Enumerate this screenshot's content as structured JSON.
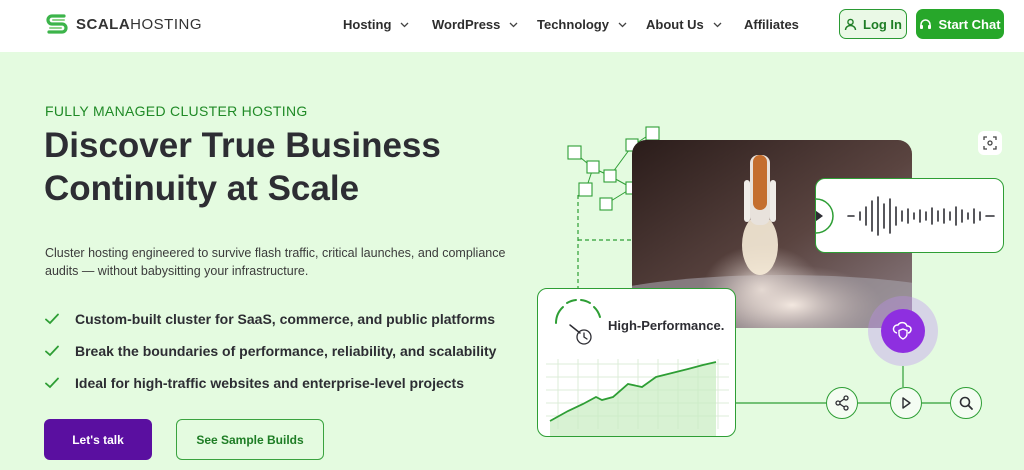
{
  "header": {
    "logo_text_bold": "SCALA",
    "logo_text_rest": "HOSTING",
    "nav": [
      {
        "label": "Hosting",
        "has_dropdown": true
      },
      {
        "label": "WordPress",
        "has_dropdown": true
      },
      {
        "label": "Technology",
        "has_dropdown": true
      },
      {
        "label": "About Us",
        "has_dropdown": true
      },
      {
        "label": "Affiliates",
        "has_dropdown": false
      }
    ],
    "login_label": "Log In",
    "chat_label": "Start Chat"
  },
  "hero": {
    "eyebrow": "FULLY MANAGED CLUSTER HOSTING",
    "headline_line1": "Discover True Business",
    "headline_line2": "Continuity at Scale",
    "subtext": "Cluster hosting engineered to survive flash traffic, critical launches, and compliance audits — without babysitting your infrastructure.",
    "features": [
      "Custom-built cluster for SaaS, commerce, and public platforms",
      "Break the boundaries of performance, reliability, and scalability",
      "Ideal for high-traffic websites and enterprise-level projects"
    ],
    "cta_primary": "Let's talk",
    "cta_secondary": "See Sample Builds"
  },
  "illustration": {
    "performance_title": "High-Performance.",
    "icons": [
      "cube-network-icon",
      "play-icon",
      "audio-wave-icon",
      "speed-gauge-icon",
      "shield-cloud-icon",
      "share-icon",
      "search-icon",
      "focus-icon"
    ]
  },
  "colors": {
    "background": "#e4fbe0",
    "brand_green": "#27a72a",
    "accent_purple": "#5a0fa0",
    "text_dark": "#2d2d33"
  }
}
